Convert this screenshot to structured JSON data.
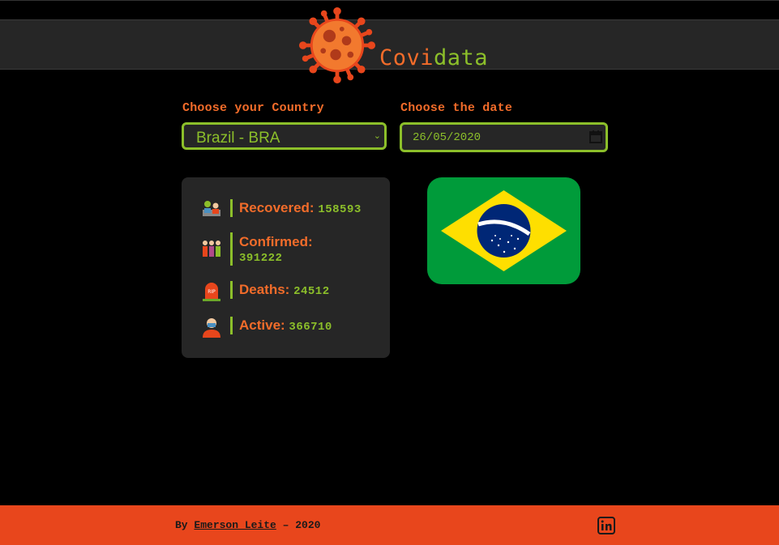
{
  "header": {
    "brand_part1": "Covi",
    "brand_part2": "data",
    "logo_icon": "virus-icon"
  },
  "form": {
    "country_label": "Choose your Country",
    "country_value": "Brazil - BRA",
    "date_label": "Choose the date",
    "date_value": "26/05/2020"
  },
  "stats": [
    {
      "label": "Recovered:",
      "value": "158593",
      "icon": "recovered-people-icon"
    },
    {
      "label": "Confirmed:",
      "value": "391222",
      "icon": "confirmed-people-icon"
    },
    {
      "label": "Deaths:",
      "value": "24512",
      "icon": "tombstone-icon"
    },
    {
      "label": "Active:",
      "value": "366710",
      "icon": "masked-person-icon"
    }
  ],
  "flag": {
    "country": "Brazil",
    "icon": "brazil-flag-icon"
  },
  "footer": {
    "by": "By",
    "author": "Emerson Leite",
    "year": "– 2020",
    "social_icon": "linkedin-icon"
  },
  "colors": {
    "background": "#000000",
    "panel": "#262626",
    "accent_orange": "#f26c2a",
    "accent_green": "#8cbf2a",
    "footer": "#e8461c"
  }
}
